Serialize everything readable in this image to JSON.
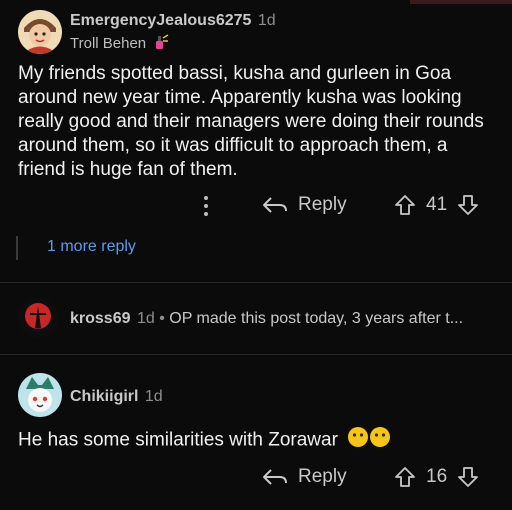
{
  "comments": [
    {
      "username": "EmergencyJealous6275",
      "age": "1d",
      "flair": "Troll Behen",
      "body": "My friends spotted bassi, kusha and gurleen in Goa around new year time. Apparently kusha was looking really good and their managers were doing their rounds around them, so it was difficult to approach them, a friend is huge fan of them.",
      "reply_label": "Reply",
      "score": "41",
      "more_replies": "1 more reply"
    },
    {
      "username": "kross69",
      "age": "1d",
      "separator": "•",
      "preview": "OP made this post today, 3 years after t..."
    },
    {
      "username": "Chikiigirl",
      "age": "1d",
      "body": "He has some similarities with Zorawar",
      "reply_label": "Reply",
      "score": "16"
    }
  ],
  "colors": {
    "background": "#0b0b0b",
    "link": "#5b9cf0",
    "emoji": "#f5c518"
  }
}
